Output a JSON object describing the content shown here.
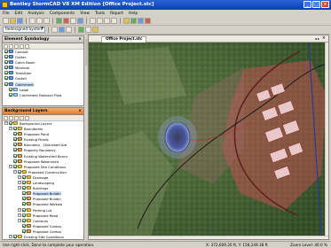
{
  "window": {
    "title": "Bentley StormCAD V8 XM Edition [Office Project.stc]"
  },
  "menu": [
    "File",
    "Edit",
    "Analysis",
    "Components",
    "View",
    "Tools",
    "Report",
    "Help"
  ],
  "toolbar": {
    "scenario_combo": "Redesigned System"
  },
  "element_symbology": {
    "title": "Element Symbology",
    "items": [
      {
        "label": "Conduit",
        "level": 0,
        "checked": true,
        "icon": "element-icon"
      },
      {
        "label": "Gutter",
        "level": 0,
        "checked": true,
        "icon": "element-icon"
      },
      {
        "label": "Catch Basin",
        "level": 0,
        "checked": true,
        "icon": "element-icon"
      },
      {
        "label": "Manhole",
        "level": 0,
        "checked": true,
        "icon": "element-icon"
      },
      {
        "label": "Transition",
        "level": 0,
        "checked": true,
        "icon": "element-icon"
      },
      {
        "label": "Outfall",
        "level": 0,
        "checked": true,
        "icon": "element-icon"
      },
      {
        "label": "Catchment",
        "level": 0,
        "checked": true,
        "icon": "element-icon",
        "selected": true
      },
      {
        "label": "Label",
        "level": 1,
        "checked": true,
        "icon": "tag-icon"
      },
      {
        "label": "Catchment Rational Flow",
        "level": 1,
        "checked": true,
        "icon": "tag-icon"
      }
    ]
  },
  "background_layers": {
    "title": "Background Layers",
    "items": [
      {
        "label": "Background Layers",
        "level": 0,
        "icon": "folder-icon"
      },
      {
        "label": "Boundaries",
        "level": 1,
        "icon": "folder-icon"
      },
      {
        "label": "Proposed Pond",
        "level": 2,
        "icon": "layer-icon"
      },
      {
        "label": "Existing Ponds",
        "level": 2,
        "icon": "layer-icon"
      },
      {
        "label": "Boundary - Disturbed Are",
        "level": 2,
        "icon": "layer-icon"
      },
      {
        "label": "Property Boundary",
        "level": 2,
        "icon": "layer-icon"
      },
      {
        "label": "Existing Watershed Bounc",
        "level": 2,
        "icon": "layer-icon"
      },
      {
        "label": "Proposed Watershed",
        "level": 2,
        "icon": "layer-icon"
      },
      {
        "label": "Proposed Site Conditions",
        "level": 1,
        "icon": "folder-icon"
      },
      {
        "label": "Proposed Construction",
        "level": 2,
        "icon": "folder-icon"
      },
      {
        "label": "Drainage",
        "level": 3,
        "icon": "folder-icon"
      },
      {
        "label": "Landscaping",
        "level": 3,
        "icon": "folder-icon"
      },
      {
        "label": "Buildings",
        "level": 3,
        "icon": "folder-icon"
      },
      {
        "label": "Proposed Buildin",
        "level": 4,
        "icon": "layer-icon",
        "selected": true
      },
      {
        "label": "Proposed Buildin",
        "level": 4,
        "icon": "layer-icon"
      },
      {
        "label": "Proposed Walkwa",
        "level": 4,
        "icon": "layer-icon"
      },
      {
        "label": "Parking Lot",
        "level": 3,
        "icon": "folder-icon"
      },
      {
        "label": "Proposed Road",
        "level": 3,
        "icon": "folder-icon"
      },
      {
        "label": "Contours",
        "level": 3,
        "icon": "folder-icon"
      },
      {
        "label": "Proposed Contou",
        "level": 4,
        "icon": "layer-icon"
      },
      {
        "label": "Proposed Contou",
        "level": 4,
        "icon": "layer-icon"
      },
      {
        "label": "Existing Site Conditions",
        "level": 1,
        "icon": "folder-icon"
      },
      {
        "label": "Existing Watershed",
        "level": 2,
        "icon": "layer-icon"
      }
    ]
  },
  "document": {
    "tab": "Office Project.stc"
  },
  "status": {
    "message": "Use right-click. Done to complete your operation.",
    "coords": "X: 372,609.20 ft, Y: 158,249.38 ft",
    "zoom": "Zoom Level: 40.0 %"
  },
  "colors": {
    "title_bar": "#0a3fb5",
    "layers_header": "#e47828",
    "catchment_fill": "#c05050",
    "pond": "#4a5aa0"
  }
}
